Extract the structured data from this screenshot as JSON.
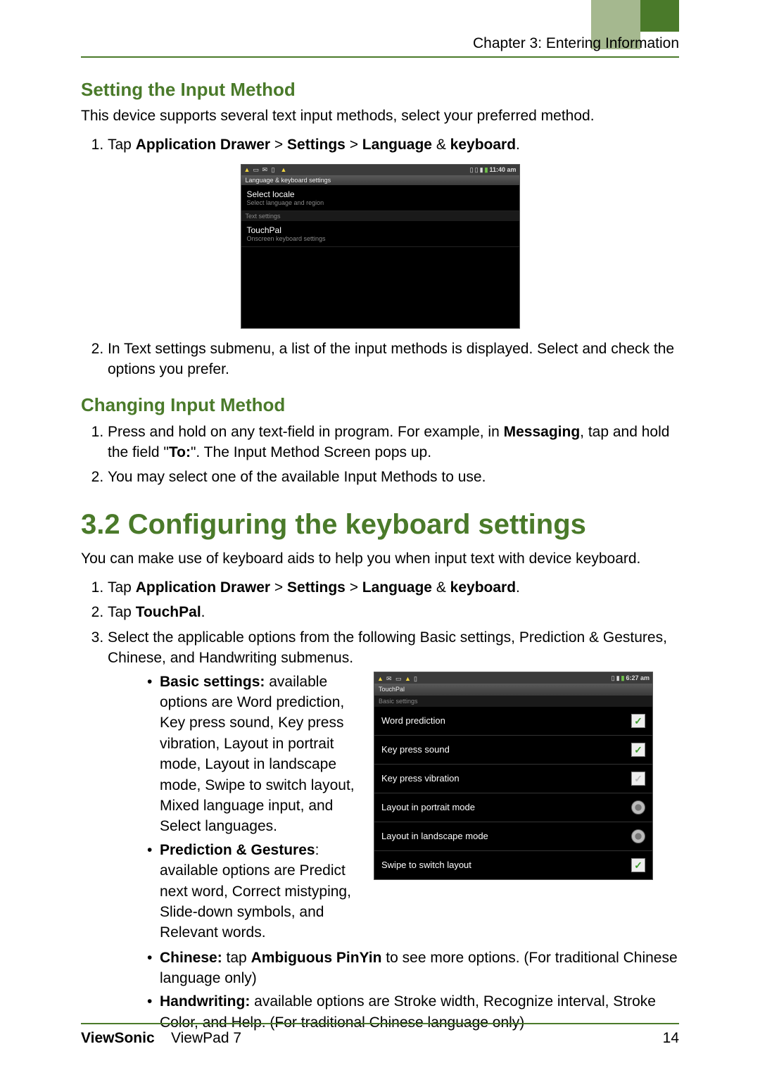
{
  "header": {
    "chapter": "Chapter 3: Entering Information"
  },
  "s1": {
    "h": "Setting the Input Method",
    "intro": "This device supports several text input methods, select your preferred method.",
    "step1_pre": "Tap ",
    "step1_b1": "Application Drawer",
    "step1_gt1": " > ",
    "step1_b2": "Settings",
    "step1_gt2": " > ",
    "step1_b3": "Language",
    "step1_amp": " & ",
    "step1_b4": "keyboard",
    "step1_post": ".",
    "step2": "In Text settings submenu, a list of the input methods is displayed. Select and check the options you prefer."
  },
  "shot1": {
    "time": "11:40 am",
    "title": "Language & keyboard settings",
    "locale_t": "Select locale",
    "locale_s": "Select language and region",
    "sect": "Text settings",
    "tp_t": "TouchPal",
    "tp_s": "Onscreen keyboard settings"
  },
  "s2": {
    "h": "Changing Input Method",
    "step1a": "Press and hold on any text-field in program. For example, in ",
    "step1b": "Messaging",
    "step1c": ", tap and hold the field \"",
    "step1d": "To:",
    "step1e": "\". The Input Method Screen pops up.",
    "step2": "You may select one of the available Input Methods to use."
  },
  "s3": {
    "h": "3.2 Configuring the keyboard settings",
    "intro": "You can make use of keyboard aids to help you when input text with device keyboard.",
    "step1_pre": "Tap ",
    "step1_b1": "Application Drawer",
    "step1_gt1": " > ",
    "step1_b2": "Settings",
    "step1_gt2": " > ",
    "step1_b3": "Language",
    "step1_amp": " & ",
    "step1_b4": "keyboard",
    "step1_post": ".",
    "step2_pre": "Tap ",
    "step2_b": "TouchPal",
    "step2_post": ".",
    "step3": "Select the applicable options from the following Basic settings, Prediction & Gestures, Chinese, and Handwriting submenus.",
    "b_basic_t": "Basic settings:",
    "b_basic_d": " available options are Word prediction, Key press sound, Key press vibration, Layout in portrait mode, Layout in landscape mode, Swipe to switch layout, Mixed language input, and Select languages.",
    "b_pred_t": "Prediction & Gestures",
    "b_pred_d": ": available options are Predict next word, Correct mistyping, Slide-down symbols, and Relevant words.",
    "b_chi_t": "Chinese:",
    "b_chi_m": " tap ",
    "b_chi_b": "Ambiguous PinYin",
    "b_chi_d": " to see more options. (For traditional Chinese language only)",
    "b_hw_t": "Handwriting:",
    "b_hw_d": " available options are Stroke width, Recognize interval, Stroke Color, and Help. (For traditional Chinese language only)"
  },
  "shot2": {
    "time": "6:27 am",
    "title": "TouchPal",
    "sect": "Basic settings",
    "r1": "Word prediction",
    "r2": "Key press sound",
    "r3": "Key press vibration",
    "r4": "Layout in portrait mode",
    "r5": "Layout in landscape mode",
    "r6": "Swipe to switch layout"
  },
  "footer": {
    "brand": "ViewSonic",
    "product": "ViewPad 7",
    "page": "14"
  }
}
